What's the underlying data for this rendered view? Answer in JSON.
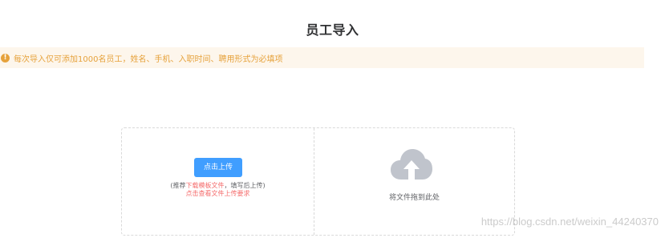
{
  "page": {
    "title": "员工导入"
  },
  "notice": {
    "icon": "warning-circle-icon",
    "text": "每次导入仅可添加1000名员工，姓名、手机、入职时间、聘用形式为必填项",
    "color": "#e6a23c",
    "background": "#fdf6ec"
  },
  "upload": {
    "button_label": "点击上传",
    "hint_prefix": "(推荐",
    "hint_link": "下载模板文件",
    "hint_suffix": "，填写后上传)",
    "requirements_link": "点击查看文件上传要求",
    "drag_text": "将文件拖到此处",
    "drag_icon": "cloud-upload-icon"
  },
  "watermark": {
    "text": "https://blog.csdn.net/weixin_44240370"
  },
  "colors": {
    "primary": "#409eff",
    "danger": "#f56c6c",
    "warning": "#e6a23c"
  }
}
